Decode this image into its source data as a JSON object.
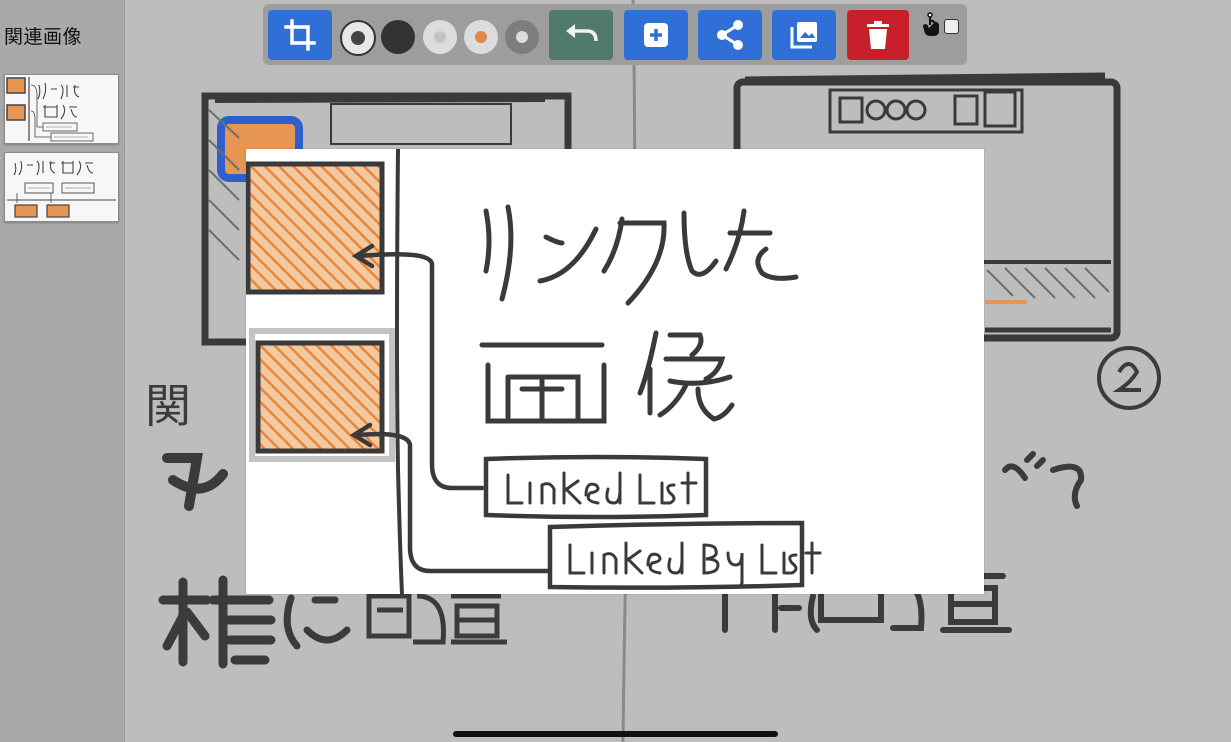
{
  "sidebar": {
    "title": "関連画像",
    "thumbnails": [
      {
        "name": "thumbnail-1"
      },
      {
        "name": "thumbnail-2"
      }
    ]
  },
  "toolbar": {
    "buttons": [
      {
        "name": "crop-button",
        "icon": "crop-icon",
        "color": "#2f6fd6"
      },
      {
        "name": "undo-button",
        "icon": "undo-icon",
        "color": "#4f7a6d"
      },
      {
        "name": "add-button",
        "icon": "plus-icon",
        "color": "#2f6fd6"
      },
      {
        "name": "share-button",
        "icon": "share-icon",
        "color": "#2f6fd6"
      },
      {
        "name": "image-button",
        "icon": "image-icon",
        "color": "#2f6fd6"
      },
      {
        "name": "delete-button",
        "icon": "trash-icon",
        "color": "#c8202a"
      }
    ],
    "pen_options": [
      {
        "name": "pen-selected",
        "color": "#444444",
        "selected": true
      },
      {
        "name": "pen-black",
        "color": "#333333"
      },
      {
        "name": "pen-light-gray",
        "color": "#c4c4c4"
      },
      {
        "name": "pen-orange",
        "color": "#e0884a"
      },
      {
        "name": "pen-dark-gray",
        "color": "#7d7d7d"
      }
    ],
    "touch_toggle": {
      "icon": "touch-icon",
      "checked": false
    }
  },
  "colors": {
    "accent_blue": "#2f6fd6",
    "danger_red": "#c8202a",
    "sketch_orange": "#e79552",
    "sketch_ink": "#3b3b3b"
  }
}
